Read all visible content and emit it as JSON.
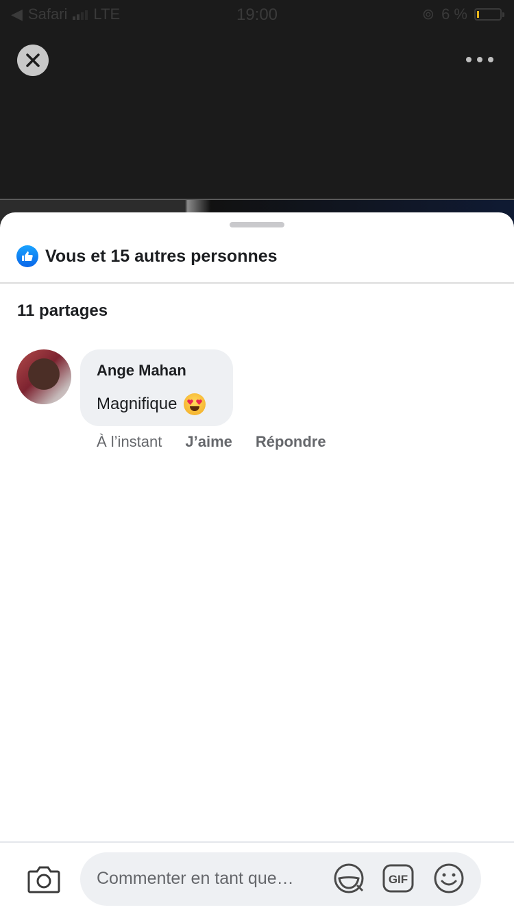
{
  "status_bar": {
    "back_app": "Safari",
    "carrier": "LTE",
    "time": "19:00",
    "battery": "6 %"
  },
  "reactions": {
    "summary": "Vous et 15 autres personnes"
  },
  "shares": {
    "label": "11 partages"
  },
  "comments": [
    {
      "author": "Ange Mahan",
      "text": "Magnifique",
      "emoji": "heart-eyes-emoji",
      "time": "À l’instant",
      "like_label": "J’aime",
      "reply_label": "Répondre"
    }
  ],
  "composer": {
    "placeholder": "Commenter en tant que…",
    "gif_label": "GIF"
  },
  "colors": {
    "like_blue": "#1877f2",
    "bubble_bg": "#eef0f3",
    "secondary_text": "#65676b"
  }
}
